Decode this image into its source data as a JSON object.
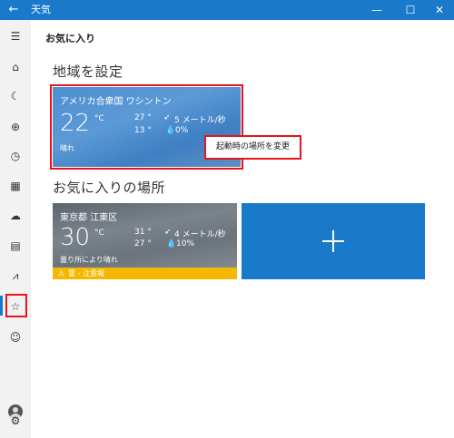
{
  "window": {
    "title": "天気",
    "back_glyph": "←",
    "minimize_glyph": "—",
    "maximize_glyph": "☐",
    "close_glyph": "✕"
  },
  "sidebar": {
    "items": [
      {
        "name": "menu-icon",
        "glyph": "☰"
      },
      {
        "name": "home-icon",
        "glyph": "⌂"
      },
      {
        "name": "forecast-icon",
        "glyph": "☾"
      },
      {
        "name": "globe-icon",
        "glyph": "⊕"
      },
      {
        "name": "clock-icon",
        "glyph": "◷"
      },
      {
        "name": "calendar-icon",
        "glyph": "▦"
      },
      {
        "name": "weather-cloud-icon",
        "glyph": "☁"
      },
      {
        "name": "news-icon",
        "glyph": "▤"
      },
      {
        "name": "chart-icon",
        "glyph": "⩘"
      },
      {
        "name": "favorites-icon",
        "glyph": "☆"
      },
      {
        "name": "smiley-icon",
        "glyph": "☺"
      }
    ],
    "settings_glyph": "⚙"
  },
  "header": {
    "page_title": "お気に入り"
  },
  "sections": {
    "home_title": "地域を設定",
    "favorites_title": "お気に入りの場所"
  },
  "home_tile": {
    "location": "アメリカ合衆国 ワシントン",
    "temperature": "22",
    "unit": "°C",
    "high": "27 °",
    "low": "13 °",
    "wind": "5 メートル/秒",
    "precip": "0%",
    "condition": "晴れ"
  },
  "favorite_tile": {
    "location": "東京都 江東区",
    "temperature": "30",
    "unit": "°C",
    "high": "31 °",
    "low": "27 °",
    "wind": "4 メートル/秒",
    "precip": "10%",
    "condition": "曇り所により晴れ",
    "warning": "雷 - 注意報"
  },
  "popup": {
    "label": "起動時の場所を変更"
  },
  "colors": {
    "accent": "#1979ca",
    "highlight": "#e8131b",
    "warning": "#f5b800"
  }
}
